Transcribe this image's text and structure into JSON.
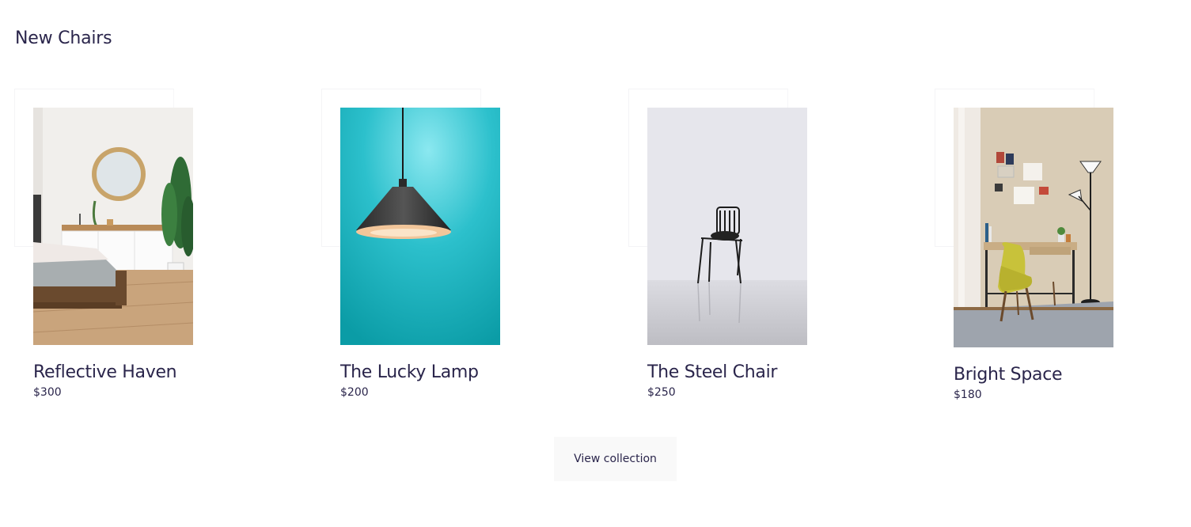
{
  "section": {
    "title": "New Chairs"
  },
  "products": [
    {
      "name": "Reflective Haven",
      "price": "$300",
      "image": "bedroom-mirror-plant-photo"
    },
    {
      "name": "The Lucky Lamp",
      "price": "$200",
      "image": "pendant-lamp-teal-photo"
    },
    {
      "name": "The Steel Chair",
      "price": "$250",
      "image": "steel-chair-photo"
    },
    {
      "name": "Bright Space",
      "price": "$180",
      "image": "yellow-chair-desk-photo"
    }
  ],
  "actions": {
    "view_collection_label": "View collection"
  },
  "colors": {
    "text": "#2a254b",
    "button_bg": "#f9f9f9",
    "lamp_bg": "#17a9b5"
  }
}
